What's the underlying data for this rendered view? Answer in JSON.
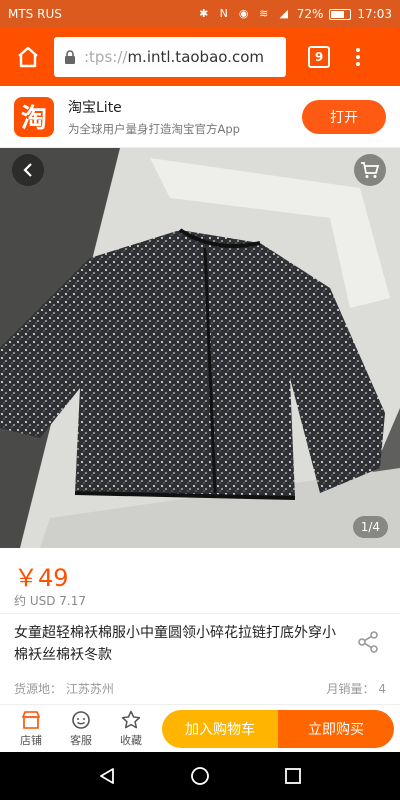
{
  "status_bar": {
    "carrier": "MTS RUS",
    "battery_percent": "72%",
    "battery_level": 0.72,
    "time": "17:03"
  },
  "browser": {
    "url_prefix": ":tps://",
    "url_domain": "m.intl.taobao.com",
    "tab_count": "9"
  },
  "app_banner": {
    "name": "淘宝Lite",
    "description": "为全球用户量身打造淘宝官方App",
    "open_label": "打开",
    "logo_char": "淘"
  },
  "gallery": {
    "counter": "1/4"
  },
  "product": {
    "price": "￥49",
    "usd_price": "约 USD 7.17",
    "title": "女童超轻棉袄棉服小中童圆领小碎花拉链打底外穿小棉袄丝棉袄冬款",
    "origin": "货源地： 江苏苏州",
    "monthly_sales": "月销量： 4"
  },
  "bottom_bar": {
    "store_label": "店铺",
    "service_label": "客服",
    "favorite_label": "收藏",
    "add_to_cart_label": "加入购物车",
    "buy_now_label": "立即购买"
  },
  "colors": {
    "accent": "#ff5000",
    "cart_button": "#ffb400",
    "buy_button": "#ff6600"
  }
}
